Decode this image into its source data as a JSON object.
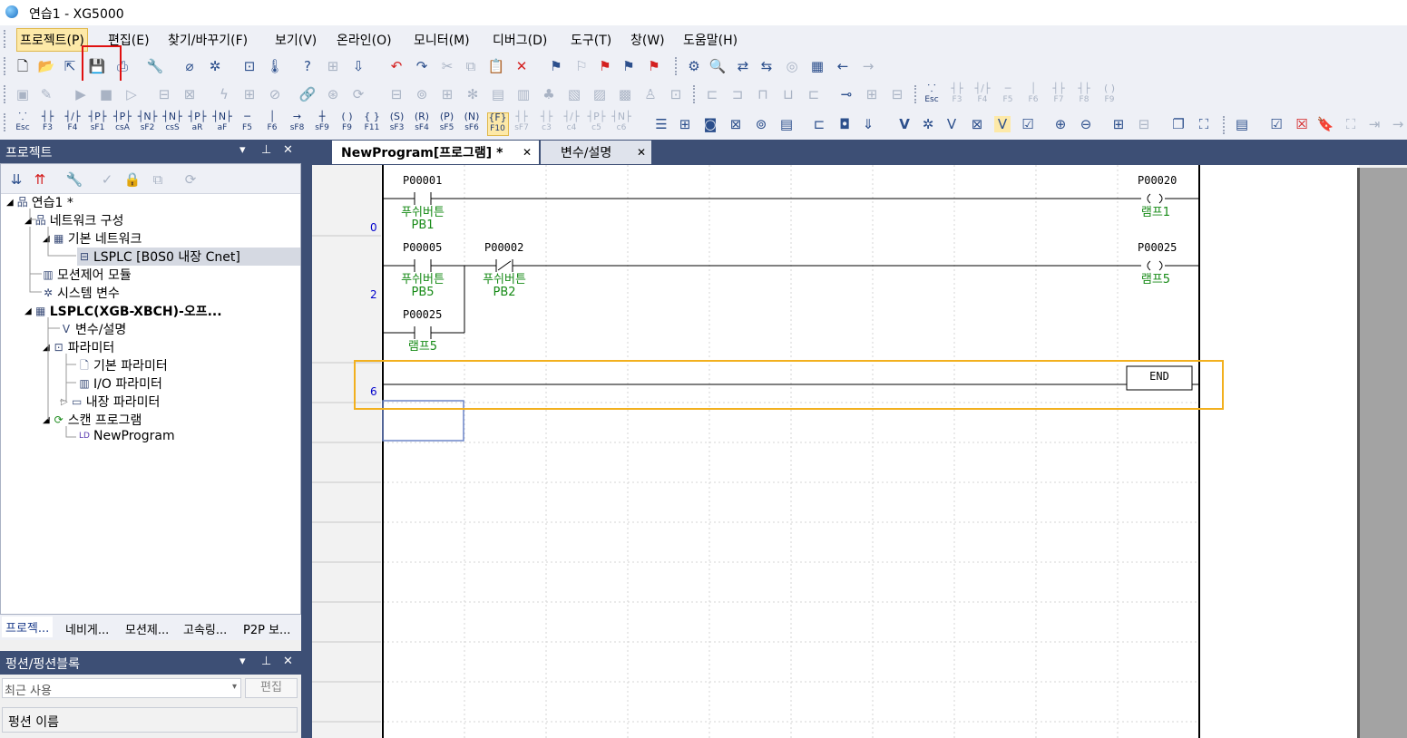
{
  "window": {
    "title": "연습1 - XG5000"
  },
  "menu": [
    "프로젝트(P)",
    "편집(E)",
    "찾기/바꾸기(F)",
    "보기(V)",
    "온라인(O)",
    "모니터(M)",
    "디버그(D)",
    "도구(T)",
    "창(W)",
    "도움말(H)"
  ],
  "fkeys_row3": [
    {
      "sym": "⸪",
      "label": "Esc"
    },
    {
      "sym": "┤├",
      "label": "F3"
    },
    {
      "sym": "┤/├",
      "label": "F4"
    },
    {
      "sym": "┤P├",
      "label": "sF1"
    },
    {
      "sym": "┤P├",
      "label": "csA"
    },
    {
      "sym": "┤N├",
      "label": "sF2"
    },
    {
      "sym": "┤N├",
      "label": "csS"
    },
    {
      "sym": "┤P├",
      "label": "aR"
    },
    {
      "sym": "┤N├",
      "label": "aF"
    },
    {
      "sym": "─",
      "label": "F5"
    },
    {
      "sym": "│",
      "label": "F6"
    },
    {
      "sym": "→",
      "label": "sF8"
    },
    {
      "sym": "┼",
      "label": "sF9"
    },
    {
      "sym": "( )",
      "label": "F9"
    },
    {
      "sym": "{ }",
      "label": "F11"
    },
    {
      "sym": "(S)",
      "label": "sF3"
    },
    {
      "sym": "(R)",
      "label": "sF4"
    },
    {
      "sym": "(P)",
      "label": "sF5"
    },
    {
      "sym": "(N)",
      "label": "sF6"
    },
    {
      "sym": "{F}",
      "label": "F10"
    },
    {
      "sym": "┤├",
      "label": "sF7"
    },
    {
      "sym": "┤├",
      "label": "c3"
    },
    {
      "sym": "┤/├",
      "label": "c4"
    },
    {
      "sym": "┤P├",
      "label": "c5"
    },
    {
      "sym": "┤N├",
      "label": "c6"
    }
  ],
  "fkeys_row2": [
    "Esc",
    "F3",
    "F4",
    "F5",
    "F6",
    "F7",
    "F8",
    "F9"
  ],
  "project_panel": {
    "title": "프로젝트",
    "tree": [
      {
        "label": "연습1 *",
        "icon": "project-icon"
      },
      {
        "label": "네트워크 구성",
        "icon": "network-icon"
      },
      {
        "label": "기본 네트워크",
        "icon": "network-basic-icon"
      },
      {
        "label": "LSPLC [B0S0 내장 Cnet]",
        "icon": "plc-icon"
      },
      {
        "label": "모션제어 모듈",
        "icon": "motion-module-icon"
      },
      {
        "label": "시스템 변수",
        "icon": "system-variable-icon"
      },
      {
        "label": "LSPLC(XGB-XBCH)-오프...",
        "icon": "plc-offline-icon"
      },
      {
        "label": "변수/설명",
        "icon": "variable-icon"
      },
      {
        "label": "파라미터",
        "icon": "parameter-icon"
      },
      {
        "label": "기본 파라미터",
        "icon": "parameter-basic-icon"
      },
      {
        "label": "I/O 파라미터",
        "icon": "io-parameter-icon"
      },
      {
        "label": "내장 파라미터",
        "icon": "builtin-parameter-icon"
      },
      {
        "label": "스캔 프로그램",
        "icon": "scan-program-icon"
      },
      {
        "label": "NewProgram",
        "icon": "ld-program-icon"
      }
    ],
    "bottom_tabs": [
      "프로젝...",
      "네비게...",
      "모션제...",
      "고속링...",
      "P2P 보..."
    ]
  },
  "function_panel": {
    "title": "펑션/펑션블록",
    "dropdown_value": "최근 사용",
    "edit_button": "편집",
    "column_header": "펑션 이름"
  },
  "tabs": [
    {
      "label": "NewProgram[프로그램] *",
      "active": true
    },
    {
      "label": "변수/설명",
      "active": false
    }
  ],
  "ladder": {
    "line_numbers": [
      "0",
      "2",
      "6"
    ],
    "rung0": {
      "contact": {
        "address": "P00001",
        "comment1": "푸쉬버튼",
        "comment2": "PB1"
      },
      "coil": {
        "address": "P00020",
        "comment": "램프1"
      }
    },
    "rung2": {
      "contact1": {
        "address": "P00005",
        "comment1": "푸쉬버튼",
        "comment2": "PB5"
      },
      "contact2": {
        "address": "P00002",
        "comment1": "푸쉬버튼",
        "comment2": "PB2"
      },
      "branch": {
        "address": "P00025",
        "comment": "램프5"
      },
      "coil": {
        "address": "P00025",
        "comment": "램프5"
      }
    },
    "end_label": "END"
  },
  "colors": {
    "panel_header": "#3d4f75",
    "comment_green": "#168a16",
    "highlight_orange": "#f2b01e",
    "annotation_red": "#e01010"
  }
}
